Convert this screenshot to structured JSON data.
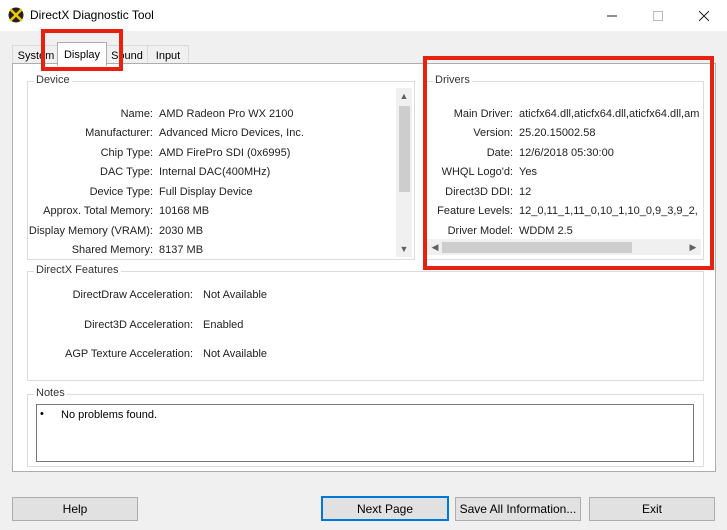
{
  "window": {
    "title": "DirectX Diagnostic Tool",
    "controls": {
      "minimize": "—",
      "maximize": "☐",
      "close": "✕"
    }
  },
  "tabs": [
    "System",
    "Display",
    "Sound",
    "Input"
  ],
  "active_tab": "Display",
  "device": {
    "label": "Device",
    "rows": [
      {
        "label": "Name:",
        "value": "AMD Radeon Pro WX 2100"
      },
      {
        "label": "Manufacturer:",
        "value": "Advanced Micro Devices, Inc."
      },
      {
        "label": "Chip Type:",
        "value": "AMD FirePro SDI (0x6995)"
      },
      {
        "label": "DAC Type:",
        "value": "Internal DAC(400MHz)"
      },
      {
        "label": "Device Type:",
        "value": "Full Display Device"
      },
      {
        "label": "Approx. Total Memory:",
        "value": "10168 MB"
      },
      {
        "label": "Display Memory (VRAM):",
        "value": "2030 MB"
      },
      {
        "label": "Shared Memory:",
        "value": "8137 MB"
      }
    ]
  },
  "drivers": {
    "label": "Drivers",
    "rows": [
      {
        "label": "Main Driver:",
        "value": "aticfx64.dll,aticfx64.dll,aticfx64.dll,am"
      },
      {
        "label": "Version:",
        "value": "25.20.15002.58"
      },
      {
        "label": "Date:",
        "value": "12/6/2018 05:30:00"
      },
      {
        "label": "WHQL Logo'd:",
        "value": "Yes"
      },
      {
        "label": "Direct3D DDI:",
        "value": "12"
      },
      {
        "label": "Feature Levels:",
        "value": "12_0,11_1,11_0,10_1,10_0,9_3,9_2,"
      },
      {
        "label": "Driver Model:",
        "value": "WDDM 2.5"
      }
    ]
  },
  "directx_features": {
    "label": "DirectX Features",
    "rows": [
      {
        "label": "DirectDraw Acceleration:",
        "value": "Not Available"
      },
      {
        "label": "Direct3D Acceleration:",
        "value": "Enabled"
      },
      {
        "label": "AGP Texture Acceleration:",
        "value": "Not Available"
      }
    ]
  },
  "notes": {
    "label": "Notes",
    "bullet": "•",
    "items": [
      "No problems found."
    ]
  },
  "buttons": {
    "help": "Help",
    "next_page": "Next Page",
    "save_all": "Save All Information...",
    "exit": "Exit"
  },
  "colors": {
    "highlight": "#e8200f",
    "accent": "#0078d7"
  }
}
